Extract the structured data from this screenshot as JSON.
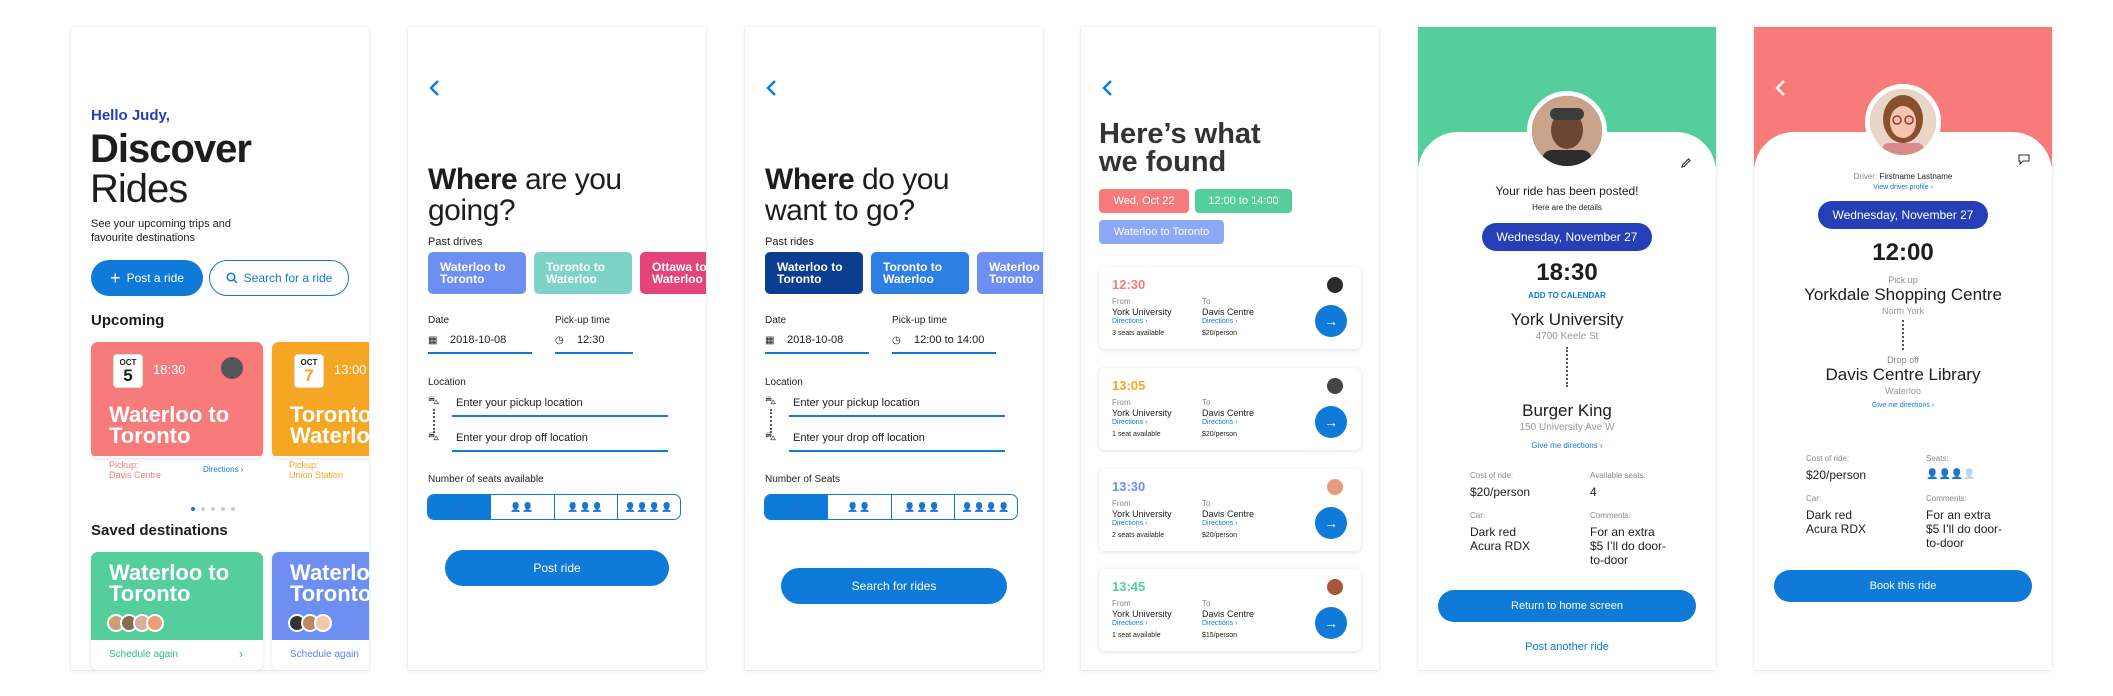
{
  "colors": {
    "primary": "#0f7ad8",
    "navy": "#2540b6",
    "red": "#f77b7b",
    "orange": "#f5a623",
    "green": "#54cf9c",
    "periwinkle": "#6d8ff2",
    "teal": "#7ed3c7",
    "pink": "#e4447a",
    "darkblue": "#0b3e91"
  },
  "s1": {
    "greeting": "Hello Judy,",
    "title_bold": "Discover",
    "title_light": "Rides",
    "subtitle": "See your upcoming trips and favourite destinations",
    "post_btn": "Post a ride",
    "search_btn": "Search for a ride",
    "upcoming": "Upcoming",
    "cards": [
      {
        "month": "OCT",
        "day": "5",
        "time": "18:30",
        "title": "Waterloo to Toronto",
        "pickup_label": "Pickup:",
        "pickup": "Davis Centre",
        "directions": "Directions ›"
      },
      {
        "month": "OCT",
        "day": "7",
        "time": "13:00",
        "title": "Toronto to Waterloo",
        "pickup_label": "Pickup:",
        "pickup": "Union Station"
      }
    ],
    "saved": "Saved destinations",
    "saved_cards": [
      {
        "title": "Waterloo to Toronto",
        "action": "Schedule again",
        "chevron": "›"
      },
      {
        "title": "Waterloo to Toronto",
        "action": "Schedule again"
      }
    ]
  },
  "s2": {
    "title_bold": "Where",
    "title_rest": " are you",
    "title_line2": "going?",
    "past": "Past drives",
    "chips": [
      "Waterloo to Toronto",
      "Toronto to Waterloo",
      "Ottawa to Waterloo"
    ],
    "date_label": "Date",
    "date": "2018-10-08",
    "time_label": "Pick-up time",
    "time": "12:30",
    "location_label": "Location",
    "pickup_ph": "Enter your pickup location",
    "dropoff_ph": "Enter your drop off location",
    "seats_label": "Number of seats available",
    "button": "Post ride"
  },
  "s3": {
    "title_bold": "Where",
    "title_rest": " do you",
    "title_line2": "want to go?",
    "past": "Past rides",
    "chips": [
      "Waterloo to Toronto",
      "Toronto to Waterloo",
      "Waterloo to Toronto"
    ],
    "date_label": "Date",
    "date": "2018-10-08",
    "time_label": "Pick-up time",
    "time": "12:00 to 14:00",
    "location_label": "Location",
    "pickup_ph": "Enter your pickup location",
    "dropoff_ph": "Enter your drop off location",
    "seats_label": "Number of Seats",
    "button": "Search for rides"
  },
  "s4": {
    "title_line1": "Here’s what",
    "title_line2": "we found",
    "tags": [
      "Wed, Oct 22",
      "12:00 to 14:00",
      "Waterloo to Toronto"
    ],
    "from_label": "From",
    "to_label": "To",
    "directions": "Directions ›",
    "results": [
      {
        "time": "12:30",
        "from": "York University",
        "to": "Davis Centre",
        "seats": "3 seats available",
        "price": "$20/person",
        "color": "#f77b7b"
      },
      {
        "time": "13:05",
        "from": "York University",
        "to": "Davis Centre",
        "seats": "1 seat available",
        "price": "$20/person",
        "color": "#f5a623"
      },
      {
        "time": "13:30",
        "from": "York University",
        "to": "Davis Centre",
        "seats": "2 seats available",
        "price": "$20/person",
        "color": "#6d8ff2"
      },
      {
        "time": "13:45",
        "from": "York University",
        "to": "Davis Centre",
        "seats": "1 seat available",
        "price": "$15/person",
        "color": "#54cf9c"
      }
    ]
  },
  "s5": {
    "posted": "Your ride has been posted!",
    "here": "Here are the details",
    "date": "Wednesday, November 27",
    "time": "18:30",
    "add_cal": "ADD TO CALENDAR",
    "from": "York University",
    "from_addr": "4700 Keele St",
    "to": "Burger King",
    "to_addr": "150 University Ave W",
    "give_dir": "Give me directions ›",
    "cost_label": "Cost of ride:",
    "cost": "$20/person",
    "seats_label": "Available seats:",
    "seats": "4",
    "car_label": "Car:",
    "car": "Dark red Acura RDX",
    "comments_label": "Comments:",
    "comments": "For an extra $5 I’ll do door-to-door",
    "home_btn": "Return to home screen",
    "another": "Post another ride"
  },
  "s6": {
    "driver_label": "Driver:",
    "driver": "Firstname Lastname",
    "profile": "View driver profile ›",
    "date": "Wednesday, November 27",
    "time": "12:00",
    "pickup_label": "Pick up",
    "pickup": "Yorkdale Shopping Centre",
    "pickup_area": "North York",
    "drop_label": "Drop off",
    "drop": "Davis Centre Library",
    "drop_area": "Waterloo",
    "give_dir": "Give me directions ›",
    "cost_label": "Cost of ride:",
    "cost": "$20/person",
    "seats_label": "Seats:",
    "car_label": "Car:",
    "car": "Dark red Acura RDX",
    "comments_label": "Comments:",
    "comments": "For an extra $5 I’ll do door-to-door",
    "button": "Book this ride"
  }
}
